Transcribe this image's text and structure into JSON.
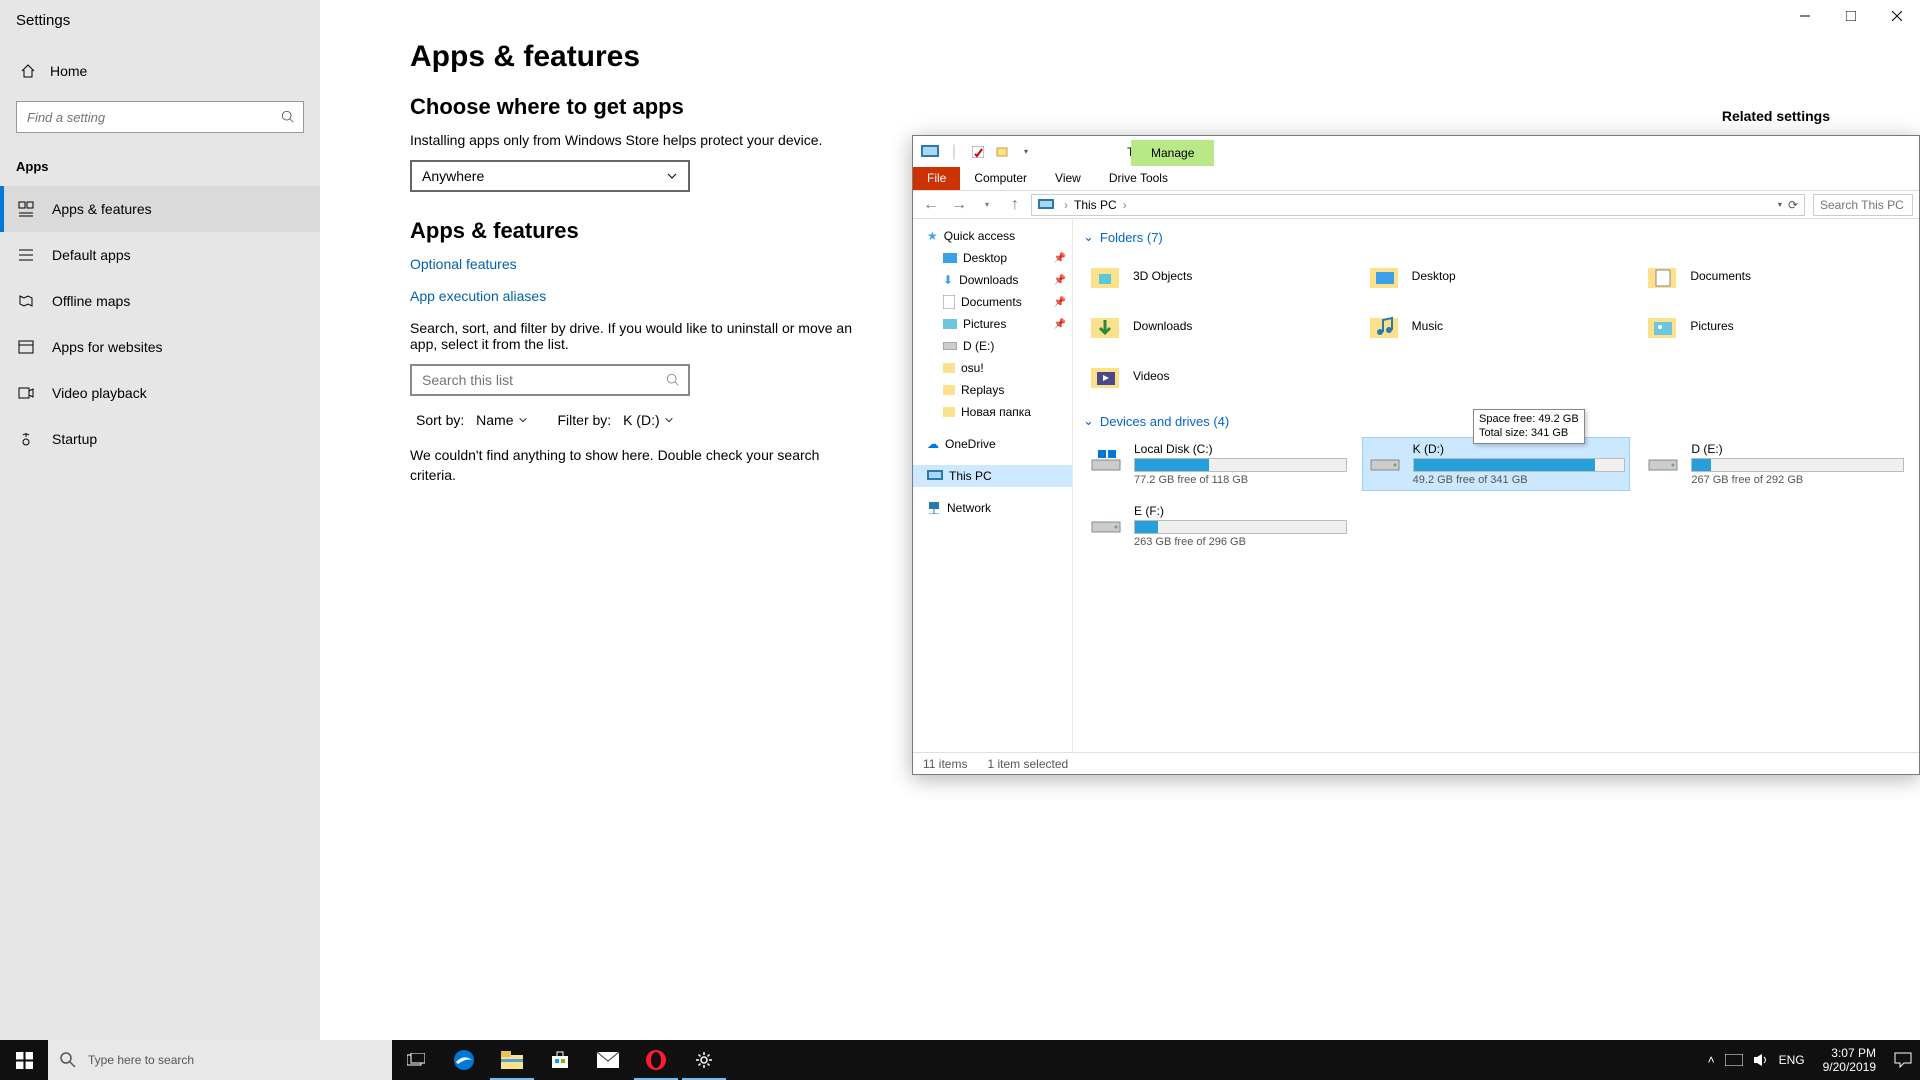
{
  "settings": {
    "title": "Settings",
    "home": "Home",
    "search_placeholder": "Find a setting",
    "section": "Apps",
    "nav": [
      {
        "label": "Apps & features",
        "icon": "apps"
      },
      {
        "label": "Default apps",
        "icon": "default"
      },
      {
        "label": "Offline maps",
        "icon": "maps"
      },
      {
        "label": "Apps for websites",
        "icon": "web"
      },
      {
        "label": "Video playback",
        "icon": "video"
      },
      {
        "label": "Startup",
        "icon": "startup"
      }
    ],
    "page_heading": "Apps & features",
    "choose_heading": "Choose where to get apps",
    "choose_desc": "Installing apps only from Windows Store helps protect your device.",
    "choose_value": "Anywhere",
    "subheading": "Apps & features",
    "link_optional": "Optional features",
    "link_aliases": "App execution aliases",
    "filter_desc": "Search, sort, and filter by drive. If you would like to uninstall or move an app, select it from the list.",
    "list_search_placeholder": "Search this list",
    "sort_label": "Sort by:",
    "sort_value": "Name",
    "filter_label": "Filter by:",
    "filter_value": "K (D:)",
    "no_results": "We couldn't find anything to show here. Double check your search criteria.",
    "related_heading": "Related settings"
  },
  "explorer": {
    "title": "This PC",
    "tabs": {
      "file": "File",
      "computer": "Computer",
      "view": "View",
      "manage": "Manage",
      "drive_tools": "Drive Tools"
    },
    "breadcrumb": "This PC",
    "search_placeholder": "Search This PC",
    "tree": {
      "quick_access": "Quick access",
      "items": [
        {
          "label": "Desktop",
          "pinned": true
        },
        {
          "label": "Downloads",
          "pinned": true
        },
        {
          "label": "Documents",
          "pinned": true
        },
        {
          "label": "Pictures",
          "pinned": true
        },
        {
          "label": "D (E:)"
        },
        {
          "label": "osu!"
        },
        {
          "label": "Replays"
        },
        {
          "label": "Новая папка"
        }
      ],
      "onedrive": "OneDrive",
      "thispc": "This PC",
      "network": "Network"
    },
    "folders_header": "Folders (7)",
    "folders": [
      "3D Objects",
      "Desktop",
      "Documents",
      "Downloads",
      "Music",
      "Pictures",
      "Videos"
    ],
    "drives_header": "Devices and drives (4)",
    "drives": [
      {
        "name": "Local Disk (C:)",
        "free": "77.2 GB free of 118 GB",
        "pct": 35,
        "logo": true
      },
      {
        "name": "K (D:)",
        "free": "49.2 GB free of 341 GB",
        "pct": 86,
        "selected": true
      },
      {
        "name": "D (E:)",
        "free": "267 GB free of 292 GB",
        "pct": 9
      },
      {
        "name": "E (F:)",
        "free": "263 GB free of 296 GB",
        "pct": 11
      }
    ],
    "tooltip": {
      "line1": "Space free: 49.2 GB",
      "line2": "Total size: 341 GB"
    },
    "status_items": "11 items",
    "status_selected": "1 item selected"
  },
  "taskbar": {
    "search_placeholder": "Type here to search",
    "lang": "ENG",
    "time": "3:07 PM",
    "date": "9/20/2019"
  }
}
